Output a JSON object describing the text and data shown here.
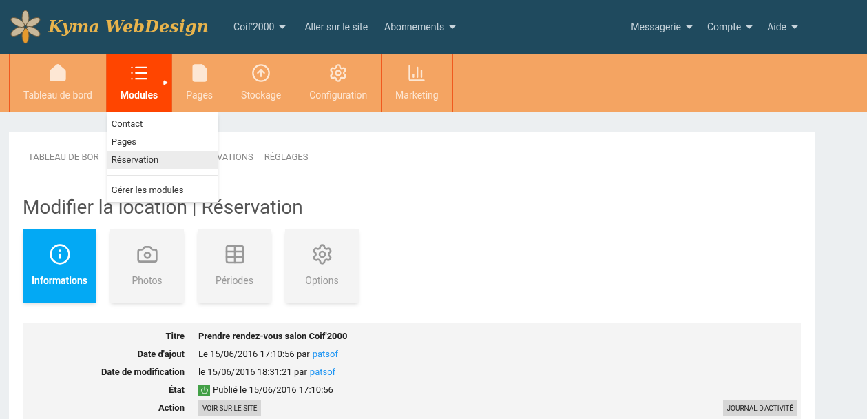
{
  "header": {
    "logo_text": "Kyma WebDesign",
    "nav_left": [
      {
        "label": "Coif'2000",
        "caret": true
      },
      {
        "label": "Aller sur le site",
        "caret": false
      },
      {
        "label": "Abonnements",
        "caret": true
      }
    ],
    "nav_right": [
      {
        "label": "Messagerie",
        "caret": true
      },
      {
        "label": "Compte",
        "caret": true
      },
      {
        "label": "Aide",
        "caret": true
      }
    ]
  },
  "main_nav": [
    {
      "label": "Tableau de bord",
      "kind": "home",
      "selected": false,
      "expanded": false
    },
    {
      "label": "Modules",
      "kind": "list",
      "selected": true,
      "expanded": true
    },
    {
      "label": "Pages",
      "kind": "page",
      "selected": false,
      "expanded": false
    },
    {
      "label": "Stockage",
      "kind": "upload",
      "selected": false,
      "expanded": false
    },
    {
      "label": "Configuration",
      "kind": "gear",
      "selected": false,
      "expanded": false
    },
    {
      "label": "Marketing",
      "kind": "chart",
      "selected": false,
      "expanded": false
    }
  ],
  "dropdown": [
    {
      "kind": "item",
      "label": "Contact",
      "selected": false
    },
    {
      "kind": "item",
      "label": "Pages",
      "selected": false
    },
    {
      "kind": "item",
      "label": "Réservation",
      "selected": true
    },
    {
      "kind": "divider"
    },
    {
      "kind": "item",
      "label": "Gérer les modules",
      "selected": false
    }
  ],
  "sub_tabs": [
    "TABLEAU DE BOR",
    "VATIONS",
    "RÉGLAGES"
  ],
  "title": "Modifier la location | Réservation",
  "tiles": [
    {
      "label": "Informations",
      "kind": "info",
      "selected": true
    },
    {
      "label": "Photos",
      "kind": "camera",
      "selected": false
    },
    {
      "label": "Périodes",
      "kind": "table",
      "selected": false
    },
    {
      "label": "Options",
      "kind": "gear",
      "selected": false
    }
  ],
  "details": [
    {
      "kind": "bold",
      "label": "Titre",
      "value": "Prendre rendez-vous salon Coif'2000"
    },
    {
      "kind": "author",
      "label": "Date d'ajout",
      "value": "Le 15/06/2016 17:10:56 par",
      "author": "patsof"
    },
    {
      "kind": "author",
      "label": "Date de modification",
      "value": "le 15/06/2016 18:31:21 par",
      "author": "patsof"
    },
    {
      "kind": "status",
      "label": "État",
      "value": "Publié le 15/06/2016 17:10:56",
      "published": true
    },
    {
      "kind": "actions",
      "label": "Action",
      "buttons": [
        "VOIR SUR LE SITE",
        "JOURNAL D'ACTIVITÉ"
      ]
    }
  ]
}
